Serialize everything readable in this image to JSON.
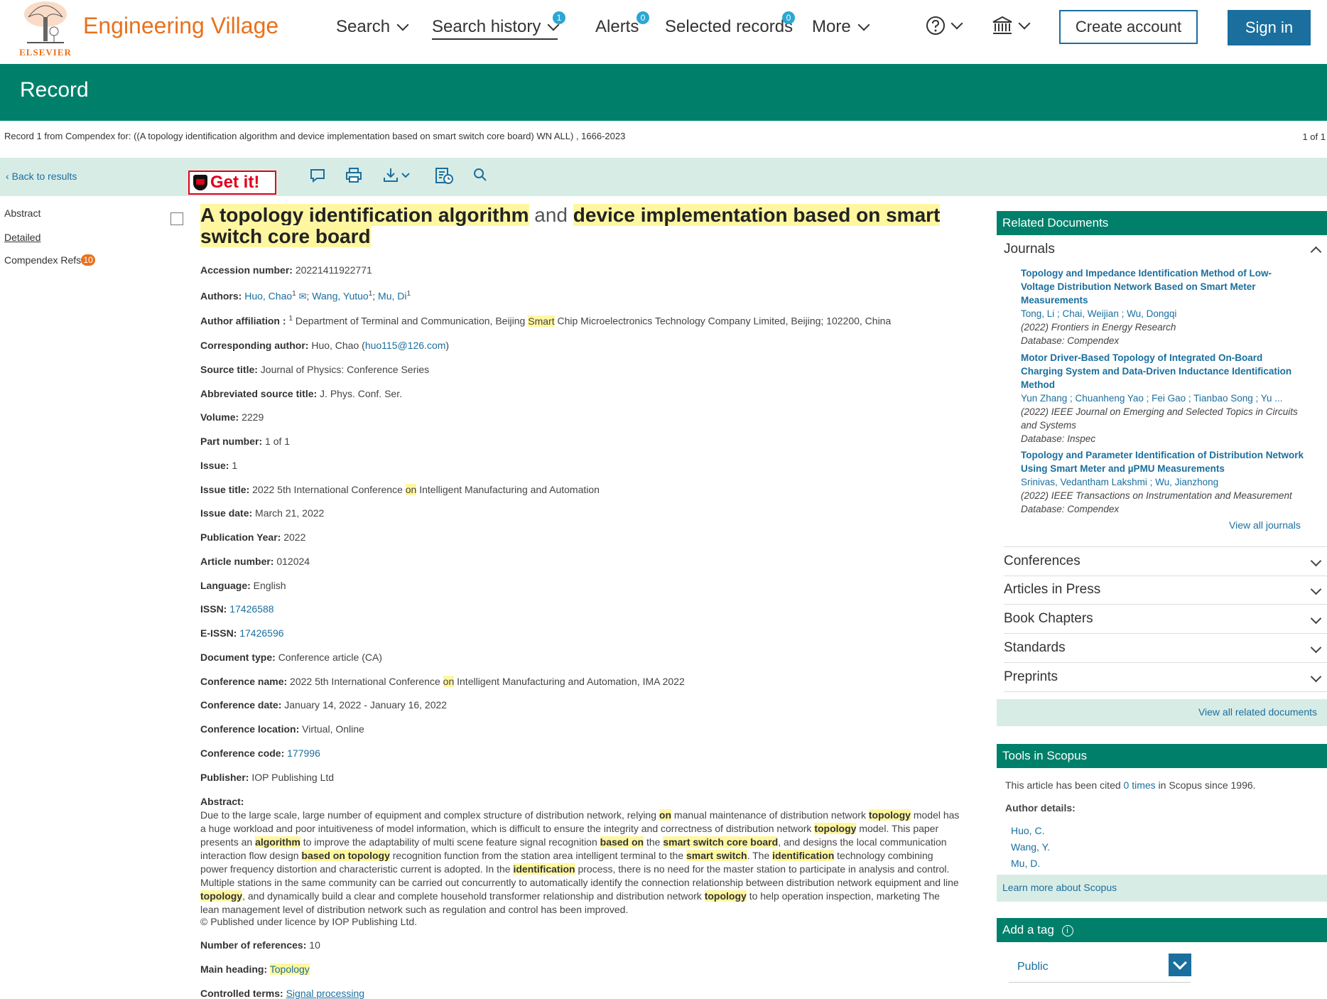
{
  "header": {
    "brand": "Engineering Village",
    "elsevier": "ELSEVIER",
    "nav": {
      "search": "Search",
      "search_history": "Search history",
      "search_history_count": "1",
      "alerts": "Alerts",
      "alerts_count": "0",
      "selected_records": "Selected records",
      "selected_count": "0",
      "more": "More"
    },
    "create_account": "Create account",
    "sign_in": "Sign in",
    "help_icon": "help-circle-icon",
    "institution_icon": "institution-icon"
  },
  "band": {
    "title": "Record"
  },
  "crumb": {
    "text": "Record 1 from Compendex for: ((A topology identification algorithm and device implementation based on smart switch core board) WN ALL) , 1666-2023",
    "pager": "1 of 1"
  },
  "toolbar": {
    "back": "Back to results",
    "getit": "Get it!",
    "icons": [
      "comment-icon",
      "print-icon",
      "download-icon",
      "history-icon",
      "search-icon"
    ]
  },
  "sidenav": {
    "abstract": "Abstract",
    "detailed": "Detailed",
    "refs": "Compendex Refs",
    "refs_count": "10"
  },
  "record": {
    "title_parts": [
      {
        "t": "A topology identification algorithm",
        "hl": true
      },
      {
        "t": " and ",
        "hl": false
      },
      {
        "t": "device implementation based on smart switch core board",
        "hl": true
      }
    ],
    "accession_label": "Accession number:",
    "accession": "20221411922771",
    "authors_label": "Authors:",
    "authors": [
      "Huo, Chao",
      "Wang, Yutuo",
      "Mu, Di"
    ],
    "affil_label": "Author affiliation :",
    "affil_pre": "Department of Terminal and Communication, Beijing ",
    "affil_hl": "Smart",
    "affil_post": " Chip Microelectronics Technology Company Limited, Beijing; 102200, China",
    "corr_label": "Corresponding author:",
    "corr_name": "Huo, Chao (",
    "corr_email": "huo115@126.com",
    "corr_close": ")",
    "source_label": "Source title:",
    "source": "Journal of Physics: Conference Series",
    "abbr_label": "Abbreviated source title:",
    "abbr": "J. Phys. Conf. Ser.",
    "volume_label": "Volume:",
    "volume": "2229",
    "part_label": "Part number:",
    "part": "1 of 1",
    "issue_label": "Issue:",
    "issue": "1",
    "issue_title_label": "Issue title:",
    "issue_title_pre": "2022 5th International Conference ",
    "issue_title_post": " Intelligent Manufacturing and Automation",
    "hl_on": "on",
    "issue_date_label": "Issue date:",
    "issue_date": "March 21, 2022",
    "pub_year_label": "Publication Year:",
    "pub_year": "2022",
    "article_label": "Article number:",
    "article": "012024",
    "lang_label": "Language:",
    "lang": "English",
    "issn_label": "ISSN:",
    "issn": "17426588",
    "eissn_label": "E-ISSN:",
    "eissn": "17426596",
    "doctype_label": "Document type:",
    "doctype": "Conference article (CA)",
    "confname_label": "Conference name:",
    "confname_pre": "2022 5th International Conference ",
    "confname_post": " Intelligent Manufacturing and Automation, IMA 2022",
    "confdate_label": "Conference date:",
    "confdate": "January 14, 2022 - January 16, 2022",
    "confloc_label": "Conference location:",
    "confloc": "Virtual, Online",
    "confcode_label": "Conference code:",
    "confcode": "177996",
    "publisher_label": "Publisher:",
    "publisher": "IOP Publishing Ltd",
    "abstract_label": "Abstract:",
    "abstract": [
      {
        "t": "Due to the large scale, large number of equipment and complex structure of distribution network, relying ",
        "hl": false
      },
      {
        "t": "on",
        "hl": true
      },
      {
        "t": " manual maintenance of distribution network ",
        "hl": false
      },
      {
        "t": "topology",
        "hl": true
      },
      {
        "t": " model has a huge workload and poor intuitiveness of model information, which is difficult to ensure the integrity and correctness of distribution network ",
        "hl": false
      },
      {
        "t": "topology",
        "hl": true
      },
      {
        "t": " model. This paper presents an ",
        "hl": false
      },
      {
        "t": "algorithm",
        "hl": true
      },
      {
        "t": " to improve the adaptability of multi scene feature signal recognition ",
        "hl": false
      },
      {
        "t": "based on",
        "hl": true
      },
      {
        "t": " the ",
        "hl": false
      },
      {
        "t": "smart switch core board",
        "hl": true
      },
      {
        "t": ", and designs the local communication interaction flow design ",
        "hl": false
      },
      {
        "t": "based on topology",
        "hl": true
      },
      {
        "t": " recognition function from the station area intelligent terminal to the ",
        "hl": false
      },
      {
        "t": "smart switch",
        "hl": true
      },
      {
        "t": ". The ",
        "hl": false
      },
      {
        "t": "identification",
        "hl": true
      },
      {
        "t": " technology combining power frequency distortion and characteristic current is adopted. In the ",
        "hl": false
      },
      {
        "t": "identification",
        "hl": true
      },
      {
        "t": " process, there is no need for the master station to participate in analysis and control. Multiple stations in the same community can be carried out concurrently to automatically identify the connection relationship between distribution network equipment and line ",
        "hl": false
      },
      {
        "t": "topology",
        "hl": true
      },
      {
        "t": ", and dynamically build a clear and complete household transformer relationship and distribution network ",
        "hl": false
      },
      {
        "t": "topology",
        "hl": true
      },
      {
        "t": " to help operation inspection, marketing The lean management level of distribution network such as regulation and control has been improved.",
        "hl": false
      }
    ],
    "license": "© Published under licence by IOP Publishing Ltd.",
    "numref_label": "Number of references:",
    "numref": "10",
    "mainhead_label": "Main heading:",
    "mainhead": "Topology",
    "controlled_label": "Controlled terms:",
    "controlled": "Signal processing"
  },
  "related": {
    "title": "Related Documents",
    "journals_label": "Journals",
    "items": [
      {
        "title": "Topology and Impedance Identification Method of Low-Voltage Distribution Network Based on Smart Meter Measurements",
        "authors": "Tong, Li ; Chai, Weijian ; Wu, Dongqi",
        "source": "(2022) Frontiers in Energy Research",
        "db": "Database: Compendex"
      },
      {
        "title": "Motor Driver-Based Topology of Integrated On-Board Charging System and Data-Driven Inductance Identification Method",
        "authors": "Yun Zhang ; Chuanheng Yao ; Fei Gao ; Tianbao Song ; Yu ...",
        "source": "(2022) IEEE Journal on Emerging and Selected Topics in Circuits and Systems",
        "db": "Database: Inspec"
      },
      {
        "title": "Topology and Parameter Identification of Distribution Network Using Smart Meter and µPMU Measurements",
        "authors": "Srinivas, Vedantham Lakshmi ; Wu, Jianzhong",
        "source": "(2022) IEEE Transactions on Instrumentation and Measurement",
        "db": "Database: Compendex"
      }
    ],
    "view_all_journals": "View all journals",
    "sections": [
      "Conferences",
      "Articles in Press",
      "Book Chapters",
      "Standards",
      "Preprints"
    ],
    "view_all_related": "View all related documents"
  },
  "scopus": {
    "title": "Tools in Scopus",
    "cited_pre": "This article has been cited ",
    "cited_link": "0 times",
    "cited_post": " in Scopus since 1996.",
    "author_details": "Author details:",
    "authors": [
      "Huo, C.",
      "Wang, Y.",
      "Mu, D."
    ],
    "learn": "Learn more about Scopus"
  },
  "tag": {
    "title": "Add a tag",
    "select": "Public"
  }
}
